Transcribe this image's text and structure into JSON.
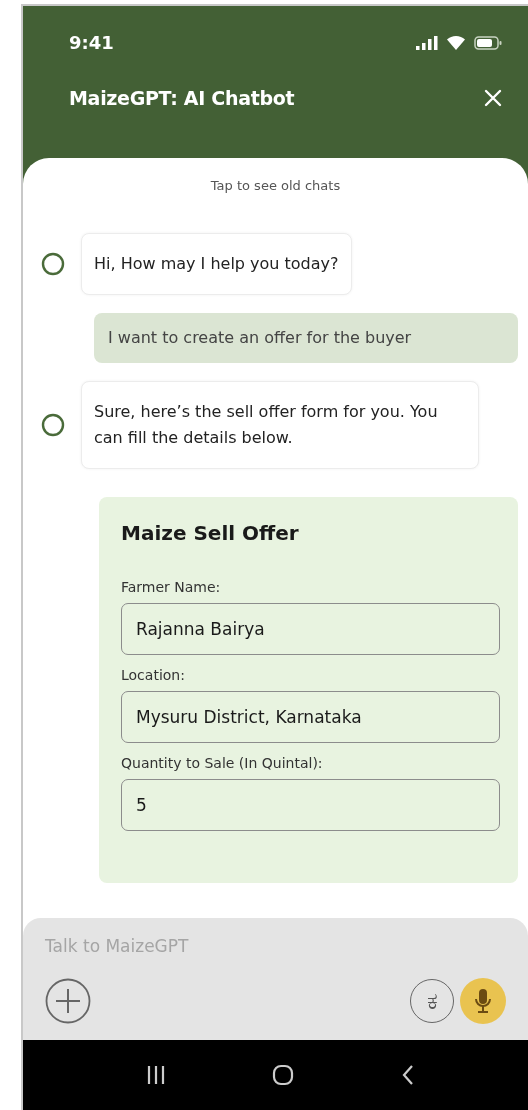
{
  "status_bar": {
    "time": "9:41"
  },
  "header": {
    "title": "MaizeGPT: AI Chatbot"
  },
  "history_link": "Tap to see old chats",
  "messages": [
    {
      "kind": "bot",
      "text": "Hi, How may I help you today?"
    },
    {
      "kind": "user",
      "text": "I want to create an offer for the buyer"
    },
    {
      "kind": "bot",
      "text": "Sure, here’s the sell offer form for you. You can fill the details below."
    }
  ],
  "offer_form": {
    "title": "Maize Sell Offer",
    "fields": [
      {
        "label": "Farmer Name:",
        "value": "Rajanna Bairya"
      },
      {
        "label": "Location:",
        "value": "Mysuru District, Karnataka"
      },
      {
        "label": "Quantity to Sale (In Quintal):",
        "value": "5"
      }
    ]
  },
  "composer": {
    "placeholder": "Talk to MaizeGPT",
    "language_key": "ಕ"
  }
}
